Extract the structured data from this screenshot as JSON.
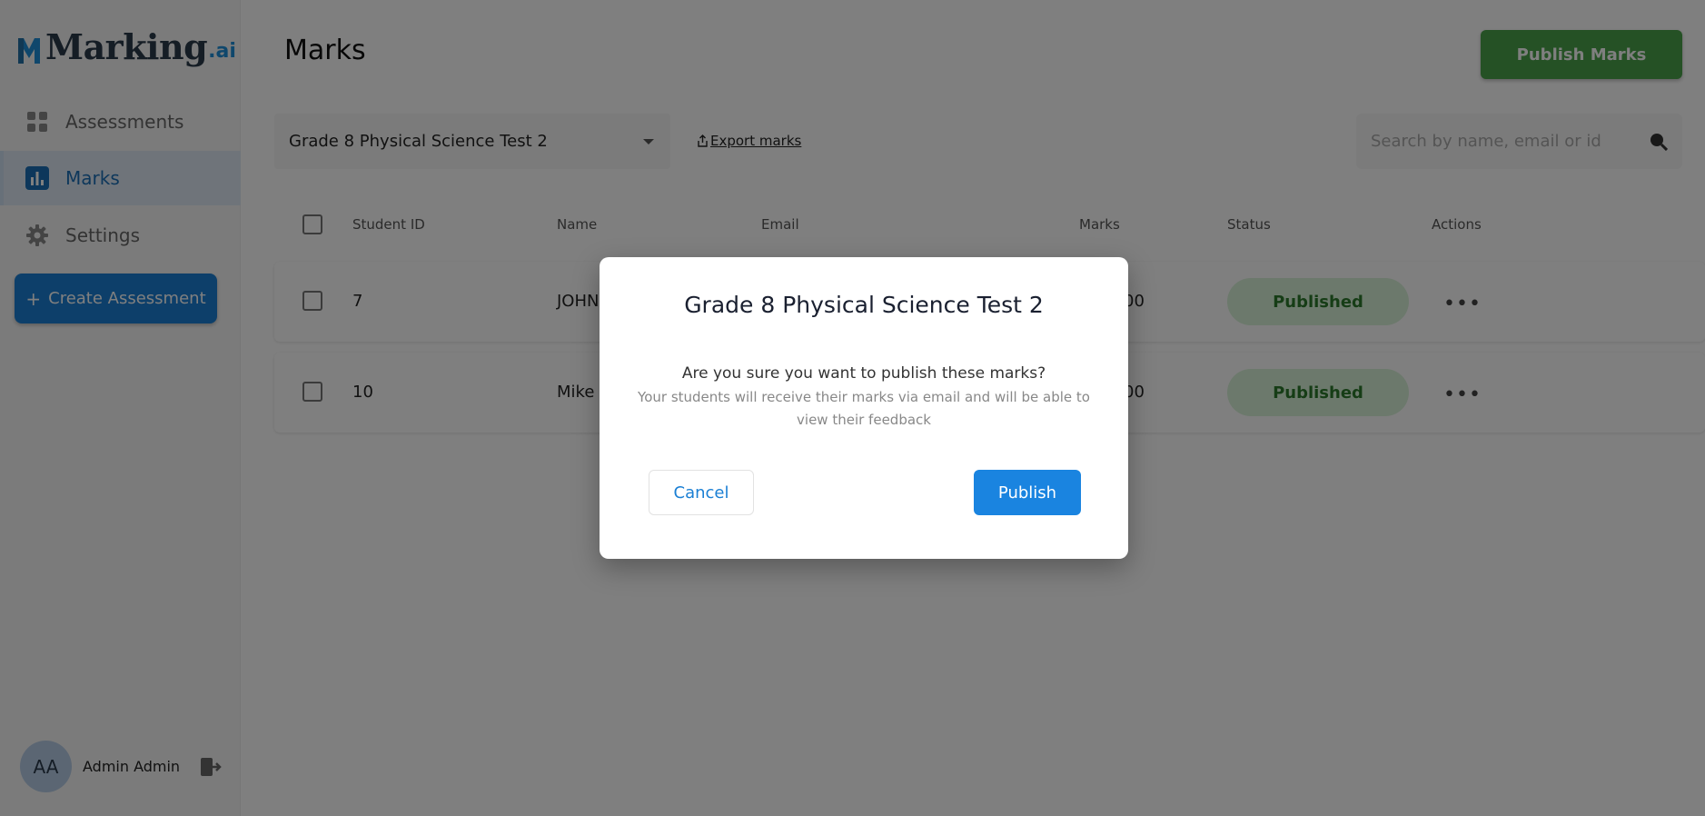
{
  "brand": {
    "name": "Marking",
    "suffix": ".ai",
    "accent": "#1f8fd8"
  },
  "sidebar": {
    "items": [
      {
        "label": "Assessments",
        "icon": "grid-icon"
      },
      {
        "label": "Marks",
        "icon": "bar-chart-icon",
        "active": true
      },
      {
        "label": "Settings",
        "icon": "gear-icon"
      }
    ],
    "create_label": "Create Assessment",
    "user": {
      "initials": "AA",
      "name": "Admin Admin"
    }
  },
  "header": {
    "title": "Marks",
    "publish_label": "Publish Marks"
  },
  "filters": {
    "assessment": "Grade 8 Physical Science Test 2",
    "export_label": "Export marks",
    "search_placeholder": "Search by name, email or id"
  },
  "table": {
    "columns": [
      "Student ID",
      "Name",
      "Email",
      "Marks",
      "Status",
      "Actions"
    ],
    "rows": [
      {
        "student_id": "7",
        "name": "JOHN",
        "marks": "00",
        "status": "Published"
      },
      {
        "student_id": "10",
        "name": "Mike T",
        "marks": "00",
        "status": "Published"
      }
    ]
  },
  "modal": {
    "title": "Grade 8 Physical Science Test 2",
    "question": "Are you sure you want to publish these marks?",
    "subtext": "Your students will receive their marks via email and will be able to view their feedback",
    "cancel_label": "Cancel",
    "confirm_label": "Publish"
  }
}
